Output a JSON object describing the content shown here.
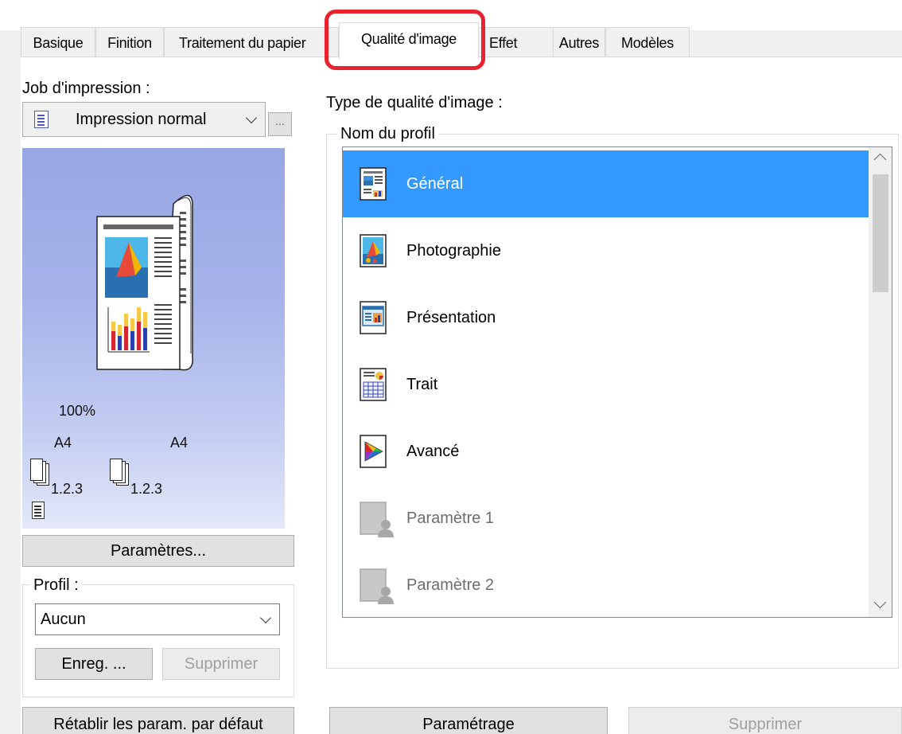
{
  "tabs": [
    {
      "label": "Basique"
    },
    {
      "label": "Finition"
    },
    {
      "label": "Traitement du papier"
    },
    {
      "label": "Qualité d'image"
    },
    {
      "label": "Effet"
    },
    {
      "label": "Autres"
    },
    {
      "label": "Modèles"
    }
  ],
  "active_tab": "Qualité d'image",
  "left": {
    "job_label": "Job d'impression :",
    "job_value": "Impression normal",
    "more_button": "...",
    "preview": {
      "scale": "100%",
      "paper_in": "A4",
      "paper_out": "A4",
      "order_in": "1.2.3",
      "order_out": "1.2.3"
    },
    "settings_button": "Paramètres...",
    "profile_label": "Profil :",
    "profile_value": "Aucun",
    "save_button": "Enreg. ...",
    "delete_button": "Supprimer",
    "reset_button": "Rétablir les param. par défaut"
  },
  "right": {
    "type_label": "Type de qualité d'image :",
    "group_title": "Nom du profil",
    "profiles": [
      {
        "name": "Général",
        "icon": "general-document-icon",
        "selected": true,
        "enabled": true
      },
      {
        "name": "Photographie",
        "icon": "photograph-icon",
        "selected": false,
        "enabled": true
      },
      {
        "name": "Présentation",
        "icon": "presentation-icon",
        "selected": false,
        "enabled": true
      },
      {
        "name": "Trait",
        "icon": "line-art-icon",
        "selected": false,
        "enabled": true
      },
      {
        "name": "Avancé",
        "icon": "advanced-color-icon",
        "selected": false,
        "enabled": true
      },
      {
        "name": "Paramètre 1",
        "icon": "custom-user-profile-icon",
        "selected": false,
        "enabled": false
      },
      {
        "name": "Paramètre 2",
        "icon": "custom-user-profile-icon",
        "selected": false,
        "enabled": false
      }
    ],
    "setup_button": "Paramétrage",
    "delete_button": "Supprimer"
  },
  "colors": {
    "selection": "#3399ff",
    "highlight_frame": "#e8222e",
    "dialog_bg": "#f0f0f0"
  }
}
